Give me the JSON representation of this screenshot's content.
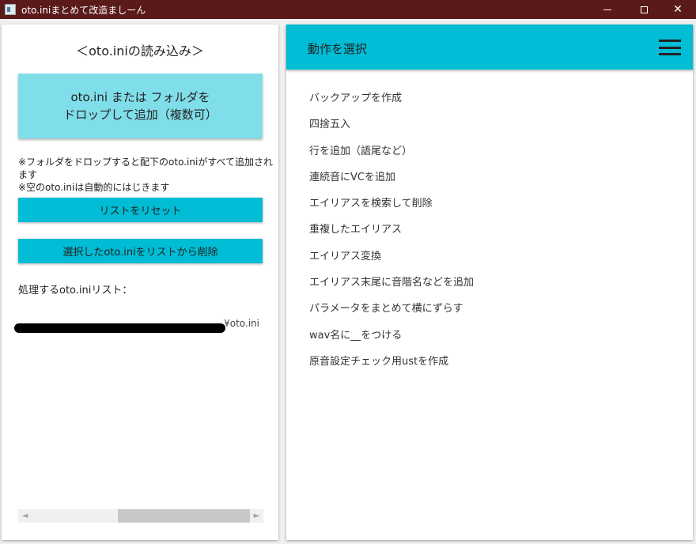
{
  "window": {
    "title": "oto.iniまとめて改造ましーん",
    "minimize_glyph": "—",
    "maximize_glyph": "☐",
    "close_glyph": "✕"
  },
  "left_panel": {
    "heading": "＜oto.iniの読み込み＞",
    "drop_zone": {
      "line1": "oto.ini または フォルダを",
      "line2": "ドロップして追加（複数可）"
    },
    "notes": [
      "※フォルダをドロップすると配下のoto.iniがすべて追加されます",
      "※空のoto.iniは自動的にはじきます"
    ],
    "reset_button": "リストをリセット",
    "remove_button": "選択したoto.iniをリストから削除",
    "list_label": "処理するoto.iniリスト：",
    "list_items": [
      {
        "visible_suffix": "¥oto.ini"
      }
    ],
    "scroll_left_glyph": "◄",
    "scroll_right_glyph": "►"
  },
  "right_panel": {
    "title": "動作を選択",
    "menu_icon": "hamburger-menu-icon",
    "menu_items": [
      "バックアップを作成",
      "四捨五入",
      "行を追加（語尾など）",
      "連続音にVCを追加",
      "エイリアスを検索して削除",
      "重複したエイリアス",
      "エイリアス変換",
      "エイリアス末尾に音階名などを追加",
      "パラメータをまとめて横にずらす",
      "wav名に__をつける",
      "原音設定チェック用ustを作成"
    ]
  },
  "colors": {
    "titlebar": "#5b1a1a",
    "accent": "#00bcd4",
    "drop_zone": "#80deea",
    "background": "#f0f0f0"
  }
}
